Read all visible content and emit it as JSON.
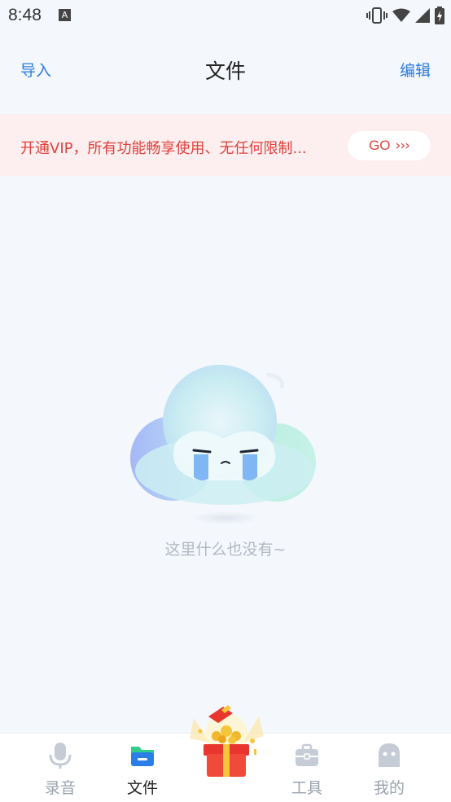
{
  "status_bar": {
    "time": "8:48",
    "notification_glyph": "A"
  },
  "header": {
    "import_label": "导入",
    "title": "文件",
    "edit_label": "编辑"
  },
  "vip_banner": {
    "text": "开通VIP，所有功能畅享使用、无任何限制...",
    "go_label": "GO",
    "go_arrows": "›››"
  },
  "empty_state": {
    "message": "这里什么也没有~"
  },
  "tabs": [
    {
      "label": "录音",
      "icon": "microphone-icon",
      "active": false
    },
    {
      "label": "文件",
      "icon": "folder-icon",
      "active": true
    },
    {
      "label": "工具",
      "icon": "toolbox-icon",
      "active": false
    },
    {
      "label": "我的",
      "icon": "profile-icon",
      "active": false
    }
  ],
  "colors": {
    "accent": "#2b7be0",
    "vip_red": "#e0413a",
    "background": "#f4f7fc"
  }
}
